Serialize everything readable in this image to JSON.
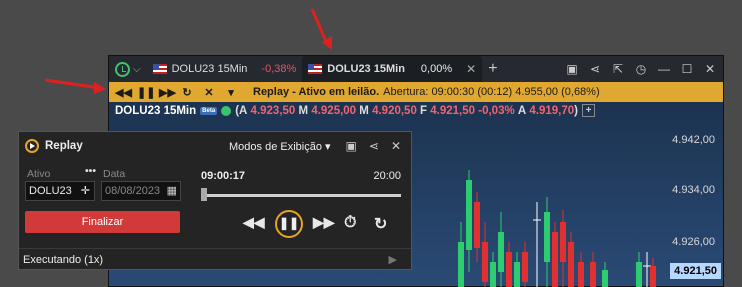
{
  "tabs": [
    {
      "symbol": "DOLU23 15Min",
      "change": "-0,38%"
    },
    {
      "symbol": "DOLU23 15Min",
      "change": "0,00%"
    }
  ],
  "replay_bar": {
    "title": "Replay - Ativo em leilão.",
    "info": "Abertura: 09:00:30 (00:12)  4.955,00 (0,68%)"
  },
  "ohlc": {
    "symbol": "DOLU23 15Min",
    "badge": "Beta",
    "a_label": "A",
    "a_value": "4.923,50",
    "m_label": "M",
    "m_value": "4.925,00",
    "min_label": "M",
    "min_value": "4.920,50",
    "f_label": "F",
    "f_value": "4.921,50",
    "change": "-0,03%",
    "last_label": "A",
    "last_value": "4.919,70"
  },
  "y_axis": [
    "4.942,00",
    "4.934,00",
    "4.926,00"
  ],
  "price_tag": "4.921,50",
  "replay_dialog": {
    "title": "Replay",
    "modes": "Modos de Exibição",
    "ativo_label": "Ativo",
    "ativo_value": "DOLU23",
    "data_label": "Data",
    "data_placeholder": "08/08/2023",
    "finalizar": "Finalizar",
    "time_start": "09:00:17",
    "time_end": "20:00",
    "status": "Executando (1x)"
  }
}
